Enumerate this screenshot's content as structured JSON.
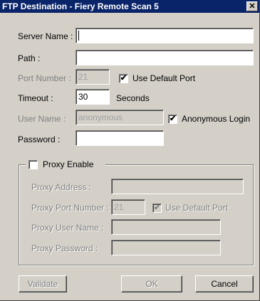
{
  "window": {
    "title": "FTP Destination - Fiery Remote Scan 5",
    "close_glyph": "✕"
  },
  "form": {
    "server_name_label": "Server Name :",
    "server_name_value": "",
    "path_label": "Path :",
    "path_value": "",
    "port_label": "Port Number :",
    "port_value": "21",
    "use_default_port_label": "Use Default Port",
    "use_default_port_checked": true,
    "timeout_label": "Timeout :",
    "timeout_value": "30",
    "timeout_unit": "Seconds",
    "user_name_label": "User Name :",
    "user_name_value": "anonymous",
    "anonymous_login_label": "Anonymous Login",
    "anonymous_login_checked": true,
    "password_label": "Password :",
    "password_value": ""
  },
  "proxy": {
    "enable_label": "Proxy Enable",
    "enable_checked": false,
    "address_label": "Proxy Address :",
    "address_value": "",
    "port_label": "Proxy Port Number :",
    "port_value": "21",
    "use_default_port_label": "Use Default Port",
    "use_default_port_checked": true,
    "user_name_label": "Proxy User Name :",
    "user_name_value": "",
    "password_label": "Proxy Password :",
    "password_value": ""
  },
  "buttons": {
    "validate_label": "Validate",
    "ok_label": "OK",
    "cancel_label": "Cancel"
  },
  "check_glyph": "✔"
}
